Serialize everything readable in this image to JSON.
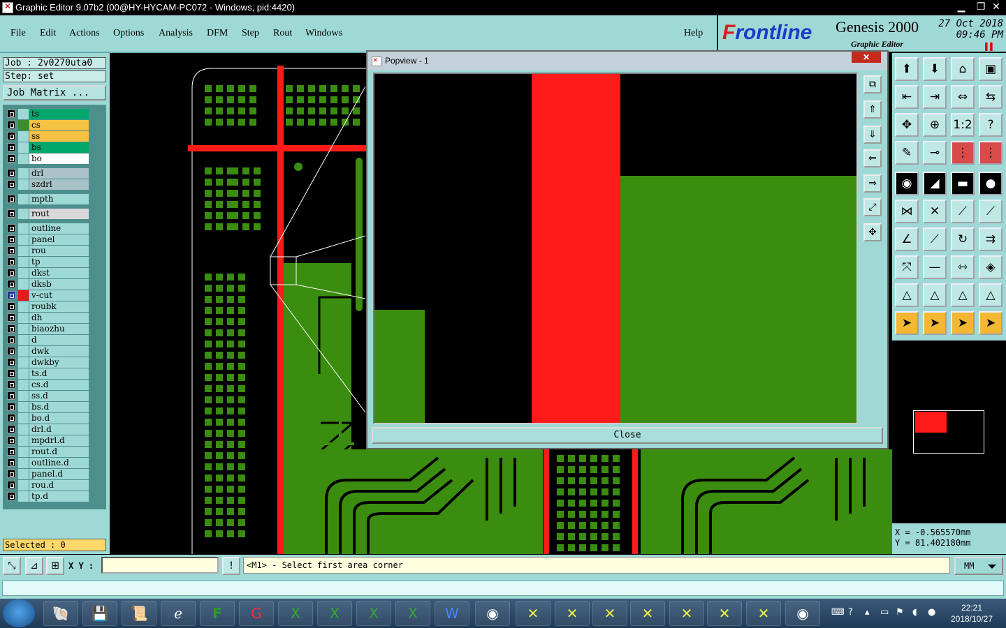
{
  "window": {
    "title": "Graphic Editor 9.07b2 (00@HY-HYCAM-PC072 - Windows, pid:4420)"
  },
  "menu": {
    "items": [
      "File",
      "Edit",
      "Actions",
      "Options",
      "Analysis",
      "DFM",
      "Step",
      "Rout",
      "Windows"
    ],
    "help": "Help"
  },
  "brand": {
    "logo_a": "F",
    "logo_b": "rontline",
    "product": "Genesis 2000",
    "subtitle": "Graphic Editor",
    "date": "27 Oct 2018",
    "time": "09:46 PM"
  },
  "job": {
    "job_line": "Job : 2v0270uta0",
    "step_line": "Step: set",
    "matrix_button": "Job Matrix ..."
  },
  "layers": [
    {
      "name": "ts",
      "color": "#00a86b",
      "swatch": "#9fd9d6"
    },
    {
      "name": "cs",
      "color": "#f6c244",
      "swatch": "#3b8d2a"
    },
    {
      "name": "ss",
      "color": "#f6c244",
      "swatch": "#9fd9d6"
    },
    {
      "name": "bs",
      "color": "#00a86b",
      "swatch": "#9fd9d6"
    },
    {
      "name": "bo",
      "color": "#ffffff",
      "swatch": "#9fd9d6"
    },
    {
      "name": "drl",
      "color": "#a9c3c8",
      "swatch": "#9fd9d6"
    },
    {
      "name": "szdrl",
      "color": "#a9c3c8",
      "swatch": "#9fd9d6"
    },
    {
      "name": "mpth",
      "color": "#9fd9d6",
      "swatch": "#9fd9d6"
    },
    {
      "name": "rout",
      "color": "#d8d8d8",
      "swatch": "#9fd9d6"
    },
    {
      "name": "outline",
      "color": "#9fd9d6",
      "swatch": "#9fd9d6"
    },
    {
      "name": "panel",
      "color": "#9fd9d6",
      "swatch": "#9fd9d6"
    },
    {
      "name": "rou",
      "color": "#9fd9d6",
      "swatch": "#9fd9d6"
    },
    {
      "name": "tp",
      "color": "#9fd9d6",
      "swatch": "#9fd9d6"
    },
    {
      "name": "dkst",
      "color": "#9fd9d6",
      "swatch": "#9fd9d6"
    },
    {
      "name": "dksb",
      "color": "#9fd9d6",
      "swatch": "#9fd9d6"
    },
    {
      "name": "v-cut",
      "color": "#9fd9d6",
      "swatch": "#e21b1b",
      "selected": true
    },
    {
      "name": "roubk",
      "color": "#9fd9d6",
      "swatch": "#9fd9d6"
    },
    {
      "name": "dh",
      "color": "#9fd9d6",
      "swatch": "#9fd9d6"
    },
    {
      "name": "biaozhu",
      "color": "#9fd9d6",
      "swatch": "#9fd9d6"
    },
    {
      "name": "d",
      "color": "#9fd9d6",
      "swatch": "#9fd9d6"
    },
    {
      "name": "dwk",
      "color": "#9fd9d6",
      "swatch": "#9fd9d6"
    },
    {
      "name": "dwkby",
      "color": "#9fd9d6",
      "swatch": "#9fd9d6"
    },
    {
      "name": "ts.d",
      "color": "#9fd9d6",
      "swatch": "#9fd9d6"
    },
    {
      "name": "cs.d",
      "color": "#9fd9d6",
      "swatch": "#9fd9d6"
    },
    {
      "name": "ss.d",
      "color": "#9fd9d6",
      "swatch": "#9fd9d6"
    },
    {
      "name": "bs.d",
      "color": "#9fd9d6",
      "swatch": "#9fd9d6"
    },
    {
      "name": "bo.d",
      "color": "#9fd9d6",
      "swatch": "#9fd9d6"
    },
    {
      "name": "drl.d",
      "color": "#9fd9d6",
      "swatch": "#9fd9d6"
    },
    {
      "name": "mpdrl.d",
      "color": "#9fd9d6",
      "swatch": "#9fd9d6"
    },
    {
      "name": "rout.d",
      "color": "#9fd9d6",
      "swatch": "#9fd9d6"
    },
    {
      "name": "outline.d",
      "color": "#9fd9d6",
      "swatch": "#9fd9d6"
    },
    {
      "name": "panel.d",
      "color": "#9fd9d6",
      "swatch": "#9fd9d6"
    },
    {
      "name": "rou.d",
      "color": "#9fd9d6",
      "swatch": "#9fd9d6"
    },
    {
      "name": "tp.d",
      "color": "#9fd9d6",
      "swatch": "#9fd9d6"
    }
  ],
  "selected_text": "Selected : 0",
  "popview": {
    "title": "Popview - 1",
    "close_label": "Close"
  },
  "coords": {
    "x": "X = -0.565570mm",
    "y": "Y = 81.402180mm"
  },
  "status": {
    "xy_label": "X Y :",
    "prompt": "<M1> - Select first area corner",
    "units": "MM"
  },
  "taskbar": {
    "time": "22:21",
    "date": "2018/10/27"
  },
  "colors": {
    "panel": "#9fd9d6",
    "copper": "#3b8d10",
    "vcut": "#ff1a1a"
  }
}
